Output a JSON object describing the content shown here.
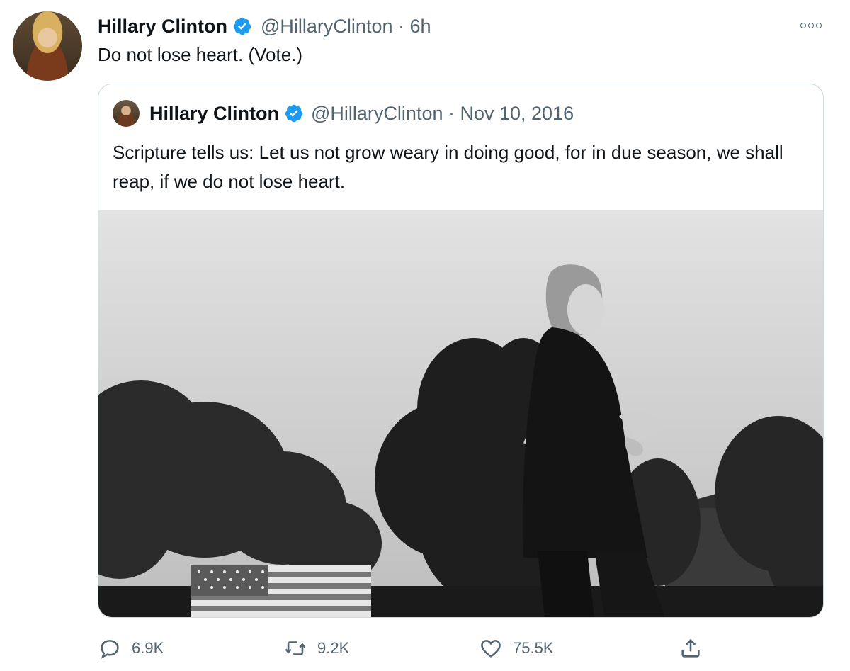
{
  "tweet": {
    "author_name": "Hillary Clinton",
    "handle_time": "@HillaryClinton · 6h",
    "text": "Do not lose heart. (Vote.)",
    "avatar_icon": "profile-photo"
  },
  "quoted": {
    "author_name": "Hillary Clinton",
    "handle_time": "@HillaryClinton · Nov 10, 2016",
    "text": "Scripture tells us: Let us not grow weary in doing good, for in due season, we shall reap, if we do not lose heart.",
    "media": "black-and-white photo of woman smiling outdoors with trees and American flag"
  },
  "actions": {
    "reply_count": "6.9K",
    "retweet_count": "9.2K",
    "like_count": "75.5K"
  },
  "colors": {
    "verified": "#1d9bf0",
    "text_primary": "#0f1419",
    "text_secondary": "#536471",
    "border": "#cfd9de"
  }
}
